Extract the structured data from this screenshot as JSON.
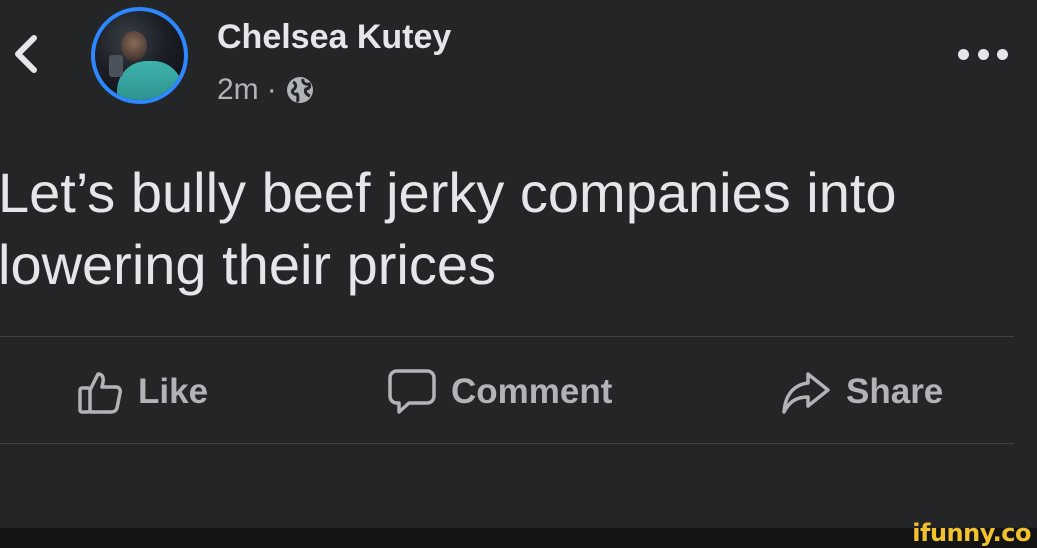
{
  "header": {
    "user_name": "Chelsea Kutey",
    "timestamp": "2m",
    "separator": "·",
    "privacy_icon": "globe-icon",
    "back_icon": "chevron-left-icon",
    "more_icon": "more-horizontal-icon"
  },
  "post": {
    "text": "Let’s bully beef jerky companies into lowering their prices"
  },
  "actions": [
    {
      "label": "Like",
      "icon": "thumbs-up-icon"
    },
    {
      "label": "Comment",
      "icon": "comment-icon"
    },
    {
      "label": "Share",
      "icon": "share-icon"
    }
  ],
  "watermark": "ifunny.co",
  "colors": {
    "background": "#242526",
    "avatar_ring": "#2d88ff",
    "primary_text": "#e4e6eb",
    "secondary_text": "#b0b3b8",
    "watermark": "#f2c12e"
  }
}
